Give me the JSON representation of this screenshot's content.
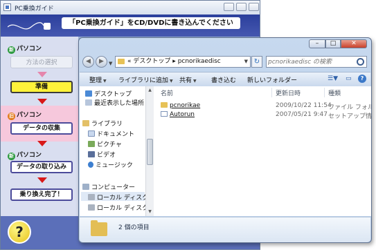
{
  "guide_window": {
    "title": "PC乗換ガイド",
    "banner": "「PC乗換ガイド」をCD/DVDに書き込んでください",
    "steps": {
      "new_pc_label_1": "パソコン",
      "new_badge": "新",
      "old_badge": "旧",
      "old_pc_label": "パソコン",
      "new_pc_label_2": "パソコン",
      "select_method": "方法の選択",
      "prepare": "準備",
      "collect_data": "データの収集",
      "import_data": "データの取り込み",
      "complete": "乗り換え完了！"
    },
    "help_label": "?"
  },
  "explorer": {
    "address": {
      "prefix": "«",
      "crumb_1": "デスクトップ",
      "separator": "▸",
      "crumb_2": "pcnorikaedisc"
    },
    "search_placeholder": "pcnorikaedisc の検索",
    "toolbar": {
      "organize": "整理",
      "add_to_library": "ライブラリに追加",
      "share": "共有",
      "burn": "書き込む",
      "new_folder": "新しいフォルダー"
    },
    "nav_tree": {
      "desktop": "デスクトップ",
      "recent": "最近表示した場所",
      "libraries": "ライブラリ",
      "documents": "ドキュメント",
      "pictures": "ピクチャ",
      "videos": "ビデオ",
      "music": "ミュージック",
      "computer": "コンピューター",
      "local_disk_1": "ローカル ディスク",
      "local_disk_2": "ローカル ディスク"
    },
    "columns": {
      "name": "名前",
      "date": "更新日時",
      "type": "種類"
    },
    "files": [
      {
        "name": "pcnorikae",
        "date": "2009/10/22 11:54",
        "type": "ファイル フォルダー"
      },
      {
        "name": "Autorun",
        "date": "2007/05/21 9:47",
        "type": "セットアップ情報"
      }
    ],
    "status": "2 個の項目"
  },
  "colors": {
    "header_blue": "#2b3f9c",
    "active_step": "#fff23a",
    "old_section_pink": "#f6c8dc",
    "arrow_red": "#d81818"
  }
}
